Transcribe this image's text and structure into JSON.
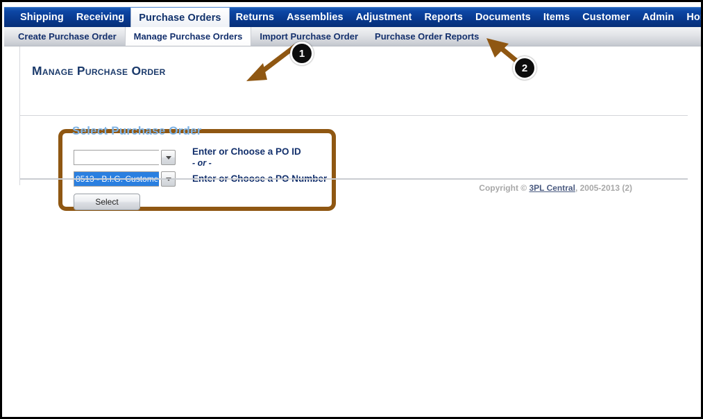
{
  "main_nav": {
    "items": [
      {
        "label": "Shipping",
        "active": false
      },
      {
        "label": "Receiving",
        "active": false
      },
      {
        "label": "Purchase Orders",
        "active": true
      },
      {
        "label": "Returns",
        "active": false
      },
      {
        "label": "Assemblies",
        "active": false
      },
      {
        "label": "Adjustment",
        "active": false
      },
      {
        "label": "Reports",
        "active": false
      },
      {
        "label": "Documents",
        "active": false
      },
      {
        "label": "Items",
        "active": false
      },
      {
        "label": "Customer",
        "active": false
      },
      {
        "label": "Admin",
        "active": false
      },
      {
        "label": "Home",
        "active": false
      }
    ]
  },
  "sub_nav": {
    "items": [
      {
        "label": "Create Purchase Order",
        "active": false
      },
      {
        "label": "Manage Purchase Orders",
        "active": true
      },
      {
        "label": "Import Purchase Order",
        "active": false
      },
      {
        "label": "Purchase Order Reports",
        "active": false
      }
    ]
  },
  "page": {
    "title": "Manage Purchase Order"
  },
  "po_panel": {
    "legend": "Select Purchase Order",
    "po_id": {
      "value": "",
      "placeholder": "",
      "label": "Enter or Choose a PO ID",
      "dropdown_icon": "chevron-down-icon"
    },
    "separator": "- or -",
    "po_number": {
      "value": "8513 - B.I.G. Custome",
      "placeholder": "",
      "label": "Enter or Choose a PO Number",
      "dropdown_icon": "chevron-down-icon",
      "selected": true
    },
    "select_button": "Select",
    "border_color": "#8f5712",
    "legend_color": "#7db2e4"
  },
  "footer": {
    "prefix": "Copyright © ",
    "link": "3PL Central",
    "suffix": ", 2005-2013 (2)"
  },
  "callouts": [
    {
      "number": "1",
      "target": "select-purchase-order-panel"
    },
    {
      "number": "2",
      "target": "purchase-order-reports-tab"
    }
  ],
  "theme": {
    "nav_blue": "#0b3d91",
    "title_navy": "#1b3a6b",
    "annotation_brown": "#8f5712",
    "badge_black": "#0d0d0d"
  }
}
